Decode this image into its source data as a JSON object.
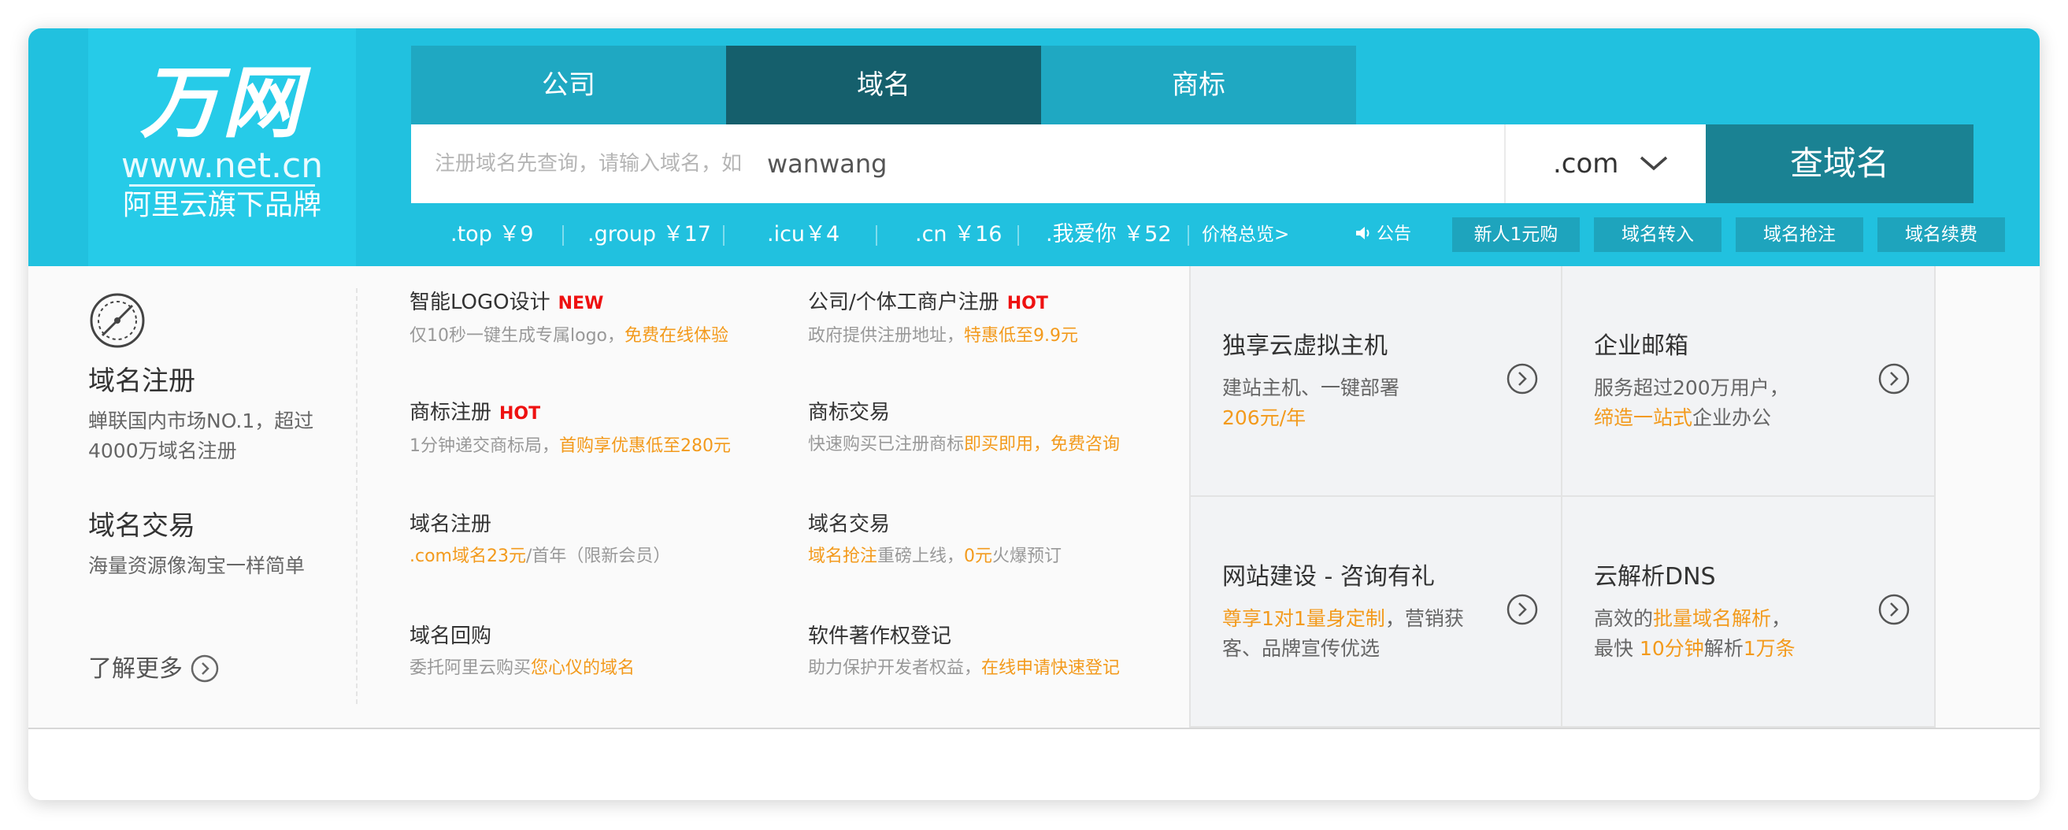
{
  "logo": {
    "brand": "万网",
    "url": "www.net.cn",
    "sub": "阿里云旗下品牌"
  },
  "tabs": [
    {
      "label": "公司",
      "active": false
    },
    {
      "label": "域名",
      "active": true
    },
    {
      "label": "商标",
      "active": false
    }
  ],
  "search": {
    "placeholder": "注册域名先查询，请输入域名，如",
    "example": "wanwang",
    "tld": ".com",
    "button": "查域名"
  },
  "prices": [
    {
      "label": ".top ￥9"
    },
    {
      "label": ".group ￥17"
    },
    {
      "label": ".icu￥4"
    },
    {
      "label": ".cn ￥16"
    },
    {
      "label": ".我爱你 ￥52"
    }
  ],
  "price_all": "价格总览>",
  "notice": "公告",
  "quick_buttons": [
    "新人1元购",
    "域名转入",
    "域名抢注",
    "域名续费"
  ],
  "left": {
    "title1": "域名注册",
    "desc1": "蝉联国内市场NO.1，超过4000万域名注册",
    "title2": "域名交易",
    "desc2": "海量资源像淘宝一样简单",
    "learn_more": "了解更多"
  },
  "services": [
    {
      "title": "智能LOGO设计",
      "badge": "NEW",
      "desc": "仅10秒一键生成专属logo，",
      "desc_hl": "免费在线体验",
      "desc_tail": ""
    },
    {
      "title": "公司/个体工商户注册",
      "badge": "HOT",
      "desc": "政府提供注册地址，",
      "desc_hl": "特惠低至9.9元",
      "desc_tail": ""
    },
    {
      "title": "商标注册",
      "badge": "HOT",
      "desc": "1分钟递交商标局，",
      "desc_hl": "首购享优惠低至280元",
      "desc_tail": ""
    },
    {
      "title": "商标交易",
      "badge": "",
      "desc": "快速购买已注册商标",
      "desc_hl": "即买即用，免费咨询",
      "desc_tail": ""
    },
    {
      "title": "域名注册",
      "badge": "",
      "desc": "",
      "desc_hl": ".com域名23元",
      "desc_tail": "/首年（限新会员）"
    },
    {
      "title": "域名交易",
      "badge": "",
      "desc": "",
      "desc_hl": "域名抢注",
      "desc_tail": "重磅上线，",
      "desc_hl2": "0元",
      "desc_tail2": "火爆预订"
    },
    {
      "title": "域名回购",
      "badge": "",
      "desc": "委托阿里云购买",
      "desc_hl": "您心仪的域名",
      "desc_tail": ""
    },
    {
      "title": "软件著作权登记",
      "badge": "",
      "desc": "助力保护开发者权益，",
      "desc_hl": "在线申请快速登记",
      "desc_tail": ""
    }
  ],
  "promos": [
    {
      "title": "独享云虚拟主机",
      "line1": "建站主机、一键部署",
      "line2_hl": "206元/年",
      "line2": ""
    },
    {
      "title": "企业邮箱",
      "line1": "服务超过200万用户，",
      "line2_hl": "缔造一站式",
      "line2": "企业办公"
    },
    {
      "title": "网站建设 - 咨询有礼",
      "line1_hl": "尊享1对1量身定制",
      "line1": "，营销获客、品牌宣传优选"
    },
    {
      "title": "云解析DNS",
      "line1": "高效的",
      "line1_hl": "批量域名解析",
      "line1_tail": "，",
      "line2": "最快 ",
      "line2_hl": "10分钟",
      "line2_mid": "解析",
      "line2_hl2": "1万条"
    }
  ],
  "colors": {
    "header": "#21c1df",
    "tab_active": "#155f6c",
    "search_button": "#1a8293",
    "highlight": "#f39a1c",
    "badge": "#ee1111"
  }
}
